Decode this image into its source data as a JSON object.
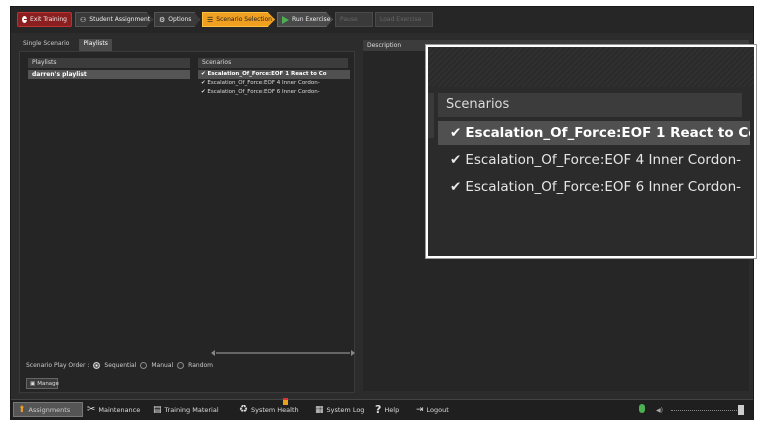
{
  "toolbar": {
    "exit_training": "Exit Training",
    "student_assignment": "Student Assignment",
    "options": "Options",
    "scenario_selection": "Scenario Selection",
    "run_exercise": "Run Exercise",
    "disabled_1": "Pause",
    "disabled_2": "Load Exercise"
  },
  "tabs": [
    {
      "label": "Single Scenario",
      "active": false
    },
    {
      "label": "Playlists",
      "active": true
    }
  ],
  "playlists": {
    "header": "Playlists",
    "items": [
      "darren's playlist"
    ]
  },
  "scenarios": {
    "header": "Scenarios",
    "items": [
      {
        "label": "Escalation_Of_Force:EOF 1 React to Co",
        "checked": true,
        "selected": true
      },
      {
        "label": "Escalation_Of_Force:EOF 4 Inner Cordon-",
        "checked": true,
        "selected": false
      },
      {
        "label": "Escalation_Of_Force:EOF 6 Inner Cordon-",
        "checked": true,
        "selected": false
      }
    ]
  },
  "play_order": {
    "label": "Scenario Play Order :",
    "options": [
      "Sequential",
      "Manual",
      "Random"
    ],
    "selected": "Sequential"
  },
  "manage_label": "Manage",
  "description_header": "Description",
  "bottom_bar": {
    "assignments": "Assignments",
    "maintenance": "Maintenance",
    "training_material": "Training Material",
    "system_health": "System Health",
    "system_log": "System Log",
    "help": "Help",
    "logout": "Logout"
  },
  "zoom": {
    "header": "Scenarios",
    "items": [
      "Escalation_Of_Force:EOF 1 React to Co",
      "Escalation_Of_Force:EOF 4 Inner Cordon-",
      "Escalation_Of_Force:EOF 6 Inner Cordon-"
    ]
  },
  "colors": {
    "exit": "#8b1e1e",
    "scenario_selection": "#f0a020",
    "run": "#4caf50",
    "panel": "#2c2c2c"
  }
}
